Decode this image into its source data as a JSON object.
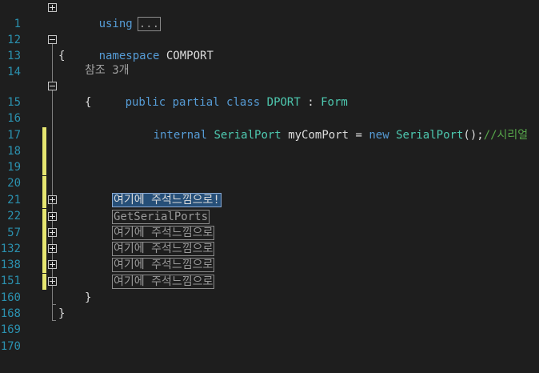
{
  "editor": {
    "line_numbers": [
      "1",
      "12",
      "13",
      "14",
      "",
      "15",
      "16",
      "17",
      "18",
      "19",
      "20",
      "21",
      "22",
      "57",
      "132",
      "138",
      "151",
      "160",
      "168",
      "169",
      "170"
    ],
    "using_keyword": "using",
    "using_collapsed": "...",
    "namespace_keyword": "namespace",
    "namespace_name": "COMPORT",
    "open_brace": "{",
    "close_brace": "}",
    "codelens_references": "참조 3개",
    "class_decl": {
      "public": "public",
      "partial": "partial",
      "class": "class",
      "name": "DPORT",
      "colon": ":",
      "base": "Form"
    },
    "field_decl": {
      "internal": "internal",
      "type": "SerialPort",
      "name": "myComPort",
      "equals": "=",
      "new": "new",
      "ctor_type": "SerialPort",
      "ctor_suffix": "();",
      "comment": "//시리얼"
    },
    "collapsed_regions": [
      "여기에 주석느낌으로!",
      "GetSerialPorts",
      "여기에 주석느낌으로",
      "여기에 주석느낌으로",
      "여기에 주석느낌으로",
      "여기에 주석느낌으로"
    ]
  }
}
